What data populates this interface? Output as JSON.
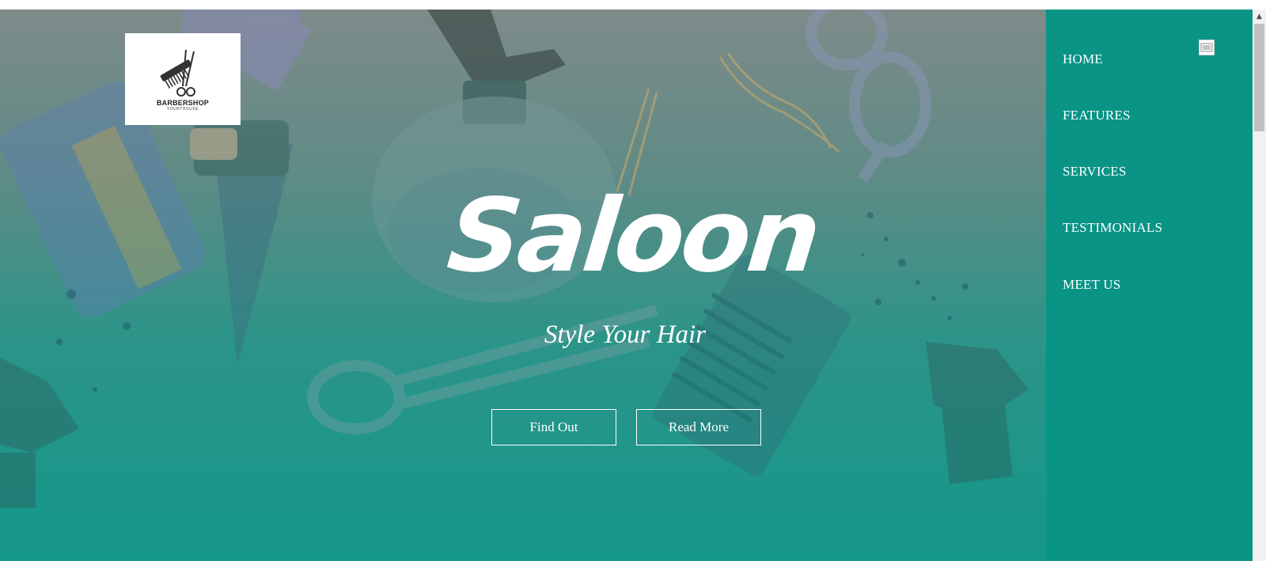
{
  "logo": {
    "title": "BARBERSHOP",
    "subtitle": "YOURTHOUSE"
  },
  "hero": {
    "title": "Saloon",
    "subtitle": "Style Your Hair",
    "buttons": {
      "find_out": "Find Out",
      "read_more": "Read More"
    }
  },
  "nav": {
    "items": [
      {
        "label": "HOME"
      },
      {
        "label": "FEATURES"
      },
      {
        "label": "SERVICES"
      },
      {
        "label": "TESTIMONIALS"
      },
      {
        "label": "MEET US"
      }
    ],
    "close_icon": "close-icon"
  },
  "colors": {
    "nav_background": "#099486",
    "hero_teal": "#14978a",
    "text": "#ffffff"
  }
}
